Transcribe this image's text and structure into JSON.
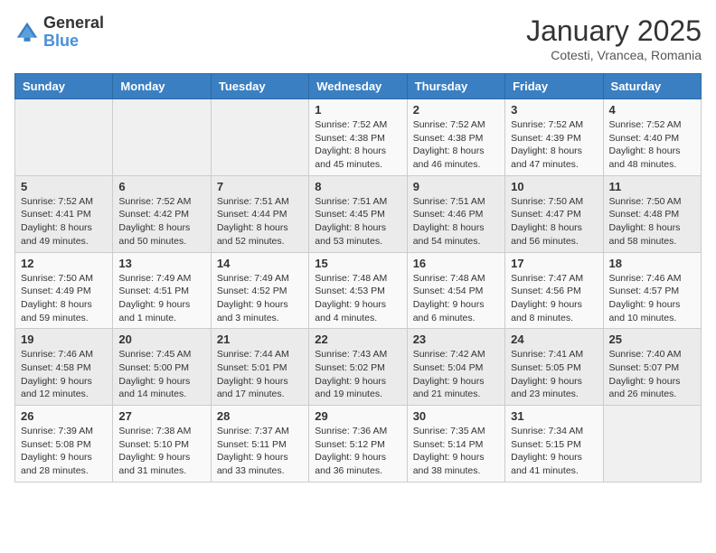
{
  "logo": {
    "general": "General",
    "blue": "Blue"
  },
  "title": "January 2025",
  "subtitle": "Cotesti, Vrancea, Romania",
  "days_of_week": [
    "Sunday",
    "Monday",
    "Tuesday",
    "Wednesday",
    "Thursday",
    "Friday",
    "Saturday"
  ],
  "weeks": [
    [
      {
        "day": "",
        "info": ""
      },
      {
        "day": "",
        "info": ""
      },
      {
        "day": "",
        "info": ""
      },
      {
        "day": "1",
        "info": "Sunrise: 7:52 AM\nSunset: 4:38 PM\nDaylight: 8 hours\nand 45 minutes."
      },
      {
        "day": "2",
        "info": "Sunrise: 7:52 AM\nSunset: 4:38 PM\nDaylight: 8 hours\nand 46 minutes."
      },
      {
        "day": "3",
        "info": "Sunrise: 7:52 AM\nSunset: 4:39 PM\nDaylight: 8 hours\nand 47 minutes."
      },
      {
        "day": "4",
        "info": "Sunrise: 7:52 AM\nSunset: 4:40 PM\nDaylight: 8 hours\nand 48 minutes."
      }
    ],
    [
      {
        "day": "5",
        "info": "Sunrise: 7:52 AM\nSunset: 4:41 PM\nDaylight: 8 hours\nand 49 minutes."
      },
      {
        "day": "6",
        "info": "Sunrise: 7:52 AM\nSunset: 4:42 PM\nDaylight: 8 hours\nand 50 minutes."
      },
      {
        "day": "7",
        "info": "Sunrise: 7:51 AM\nSunset: 4:44 PM\nDaylight: 8 hours\nand 52 minutes."
      },
      {
        "day": "8",
        "info": "Sunrise: 7:51 AM\nSunset: 4:45 PM\nDaylight: 8 hours\nand 53 minutes."
      },
      {
        "day": "9",
        "info": "Sunrise: 7:51 AM\nSunset: 4:46 PM\nDaylight: 8 hours\nand 54 minutes."
      },
      {
        "day": "10",
        "info": "Sunrise: 7:50 AM\nSunset: 4:47 PM\nDaylight: 8 hours\nand 56 minutes."
      },
      {
        "day": "11",
        "info": "Sunrise: 7:50 AM\nSunset: 4:48 PM\nDaylight: 8 hours\nand 58 minutes."
      }
    ],
    [
      {
        "day": "12",
        "info": "Sunrise: 7:50 AM\nSunset: 4:49 PM\nDaylight: 8 hours\nand 59 minutes."
      },
      {
        "day": "13",
        "info": "Sunrise: 7:49 AM\nSunset: 4:51 PM\nDaylight: 9 hours\nand 1 minute."
      },
      {
        "day": "14",
        "info": "Sunrise: 7:49 AM\nSunset: 4:52 PM\nDaylight: 9 hours\nand 3 minutes."
      },
      {
        "day": "15",
        "info": "Sunrise: 7:48 AM\nSunset: 4:53 PM\nDaylight: 9 hours\nand 4 minutes."
      },
      {
        "day": "16",
        "info": "Sunrise: 7:48 AM\nSunset: 4:54 PM\nDaylight: 9 hours\nand 6 minutes."
      },
      {
        "day": "17",
        "info": "Sunrise: 7:47 AM\nSunset: 4:56 PM\nDaylight: 9 hours\nand 8 minutes."
      },
      {
        "day": "18",
        "info": "Sunrise: 7:46 AM\nSunset: 4:57 PM\nDaylight: 9 hours\nand 10 minutes."
      }
    ],
    [
      {
        "day": "19",
        "info": "Sunrise: 7:46 AM\nSunset: 4:58 PM\nDaylight: 9 hours\nand 12 minutes."
      },
      {
        "day": "20",
        "info": "Sunrise: 7:45 AM\nSunset: 5:00 PM\nDaylight: 9 hours\nand 14 minutes."
      },
      {
        "day": "21",
        "info": "Sunrise: 7:44 AM\nSunset: 5:01 PM\nDaylight: 9 hours\nand 17 minutes."
      },
      {
        "day": "22",
        "info": "Sunrise: 7:43 AM\nSunset: 5:02 PM\nDaylight: 9 hours\nand 19 minutes."
      },
      {
        "day": "23",
        "info": "Sunrise: 7:42 AM\nSunset: 5:04 PM\nDaylight: 9 hours\nand 21 minutes."
      },
      {
        "day": "24",
        "info": "Sunrise: 7:41 AM\nSunset: 5:05 PM\nDaylight: 9 hours\nand 23 minutes."
      },
      {
        "day": "25",
        "info": "Sunrise: 7:40 AM\nSunset: 5:07 PM\nDaylight: 9 hours\nand 26 minutes."
      }
    ],
    [
      {
        "day": "26",
        "info": "Sunrise: 7:39 AM\nSunset: 5:08 PM\nDaylight: 9 hours\nand 28 minutes."
      },
      {
        "day": "27",
        "info": "Sunrise: 7:38 AM\nSunset: 5:10 PM\nDaylight: 9 hours\nand 31 minutes."
      },
      {
        "day": "28",
        "info": "Sunrise: 7:37 AM\nSunset: 5:11 PM\nDaylight: 9 hours\nand 33 minutes."
      },
      {
        "day": "29",
        "info": "Sunrise: 7:36 AM\nSunset: 5:12 PM\nDaylight: 9 hours\nand 36 minutes."
      },
      {
        "day": "30",
        "info": "Sunrise: 7:35 AM\nSunset: 5:14 PM\nDaylight: 9 hours\nand 38 minutes."
      },
      {
        "day": "31",
        "info": "Sunrise: 7:34 AM\nSunset: 5:15 PM\nDaylight: 9 hours\nand 41 minutes."
      },
      {
        "day": "",
        "info": ""
      }
    ]
  ]
}
